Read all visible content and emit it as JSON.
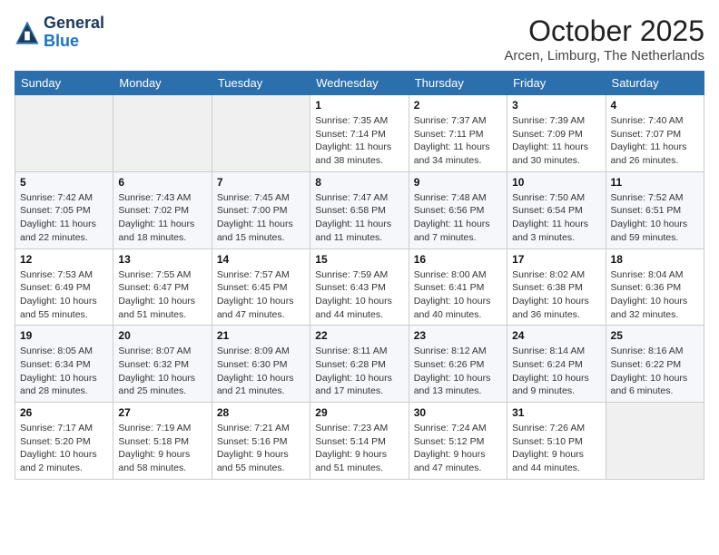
{
  "header": {
    "logo_line1": "General",
    "logo_line2": "Blue",
    "month": "October 2025",
    "location": "Arcen, Limburg, The Netherlands"
  },
  "weekdays": [
    "Sunday",
    "Monday",
    "Tuesday",
    "Wednesday",
    "Thursday",
    "Friday",
    "Saturday"
  ],
  "weeks": [
    [
      {
        "day": "",
        "info": ""
      },
      {
        "day": "",
        "info": ""
      },
      {
        "day": "",
        "info": ""
      },
      {
        "day": "1",
        "info": "Sunrise: 7:35 AM\nSunset: 7:14 PM\nDaylight: 11 hours\nand 38 minutes."
      },
      {
        "day": "2",
        "info": "Sunrise: 7:37 AM\nSunset: 7:11 PM\nDaylight: 11 hours\nand 34 minutes."
      },
      {
        "day": "3",
        "info": "Sunrise: 7:39 AM\nSunset: 7:09 PM\nDaylight: 11 hours\nand 30 minutes."
      },
      {
        "day": "4",
        "info": "Sunrise: 7:40 AM\nSunset: 7:07 PM\nDaylight: 11 hours\nand 26 minutes."
      }
    ],
    [
      {
        "day": "5",
        "info": "Sunrise: 7:42 AM\nSunset: 7:05 PM\nDaylight: 11 hours\nand 22 minutes."
      },
      {
        "day": "6",
        "info": "Sunrise: 7:43 AM\nSunset: 7:02 PM\nDaylight: 11 hours\nand 18 minutes."
      },
      {
        "day": "7",
        "info": "Sunrise: 7:45 AM\nSunset: 7:00 PM\nDaylight: 11 hours\nand 15 minutes."
      },
      {
        "day": "8",
        "info": "Sunrise: 7:47 AM\nSunset: 6:58 PM\nDaylight: 11 hours\nand 11 minutes."
      },
      {
        "day": "9",
        "info": "Sunrise: 7:48 AM\nSunset: 6:56 PM\nDaylight: 11 hours\nand 7 minutes."
      },
      {
        "day": "10",
        "info": "Sunrise: 7:50 AM\nSunset: 6:54 PM\nDaylight: 11 hours\nand 3 minutes."
      },
      {
        "day": "11",
        "info": "Sunrise: 7:52 AM\nSunset: 6:51 PM\nDaylight: 10 hours\nand 59 minutes."
      }
    ],
    [
      {
        "day": "12",
        "info": "Sunrise: 7:53 AM\nSunset: 6:49 PM\nDaylight: 10 hours\nand 55 minutes."
      },
      {
        "day": "13",
        "info": "Sunrise: 7:55 AM\nSunset: 6:47 PM\nDaylight: 10 hours\nand 51 minutes."
      },
      {
        "day": "14",
        "info": "Sunrise: 7:57 AM\nSunset: 6:45 PM\nDaylight: 10 hours\nand 47 minutes."
      },
      {
        "day": "15",
        "info": "Sunrise: 7:59 AM\nSunset: 6:43 PM\nDaylight: 10 hours\nand 44 minutes."
      },
      {
        "day": "16",
        "info": "Sunrise: 8:00 AM\nSunset: 6:41 PM\nDaylight: 10 hours\nand 40 minutes."
      },
      {
        "day": "17",
        "info": "Sunrise: 8:02 AM\nSunset: 6:38 PM\nDaylight: 10 hours\nand 36 minutes."
      },
      {
        "day": "18",
        "info": "Sunrise: 8:04 AM\nSunset: 6:36 PM\nDaylight: 10 hours\nand 32 minutes."
      }
    ],
    [
      {
        "day": "19",
        "info": "Sunrise: 8:05 AM\nSunset: 6:34 PM\nDaylight: 10 hours\nand 28 minutes."
      },
      {
        "day": "20",
        "info": "Sunrise: 8:07 AM\nSunset: 6:32 PM\nDaylight: 10 hours\nand 25 minutes."
      },
      {
        "day": "21",
        "info": "Sunrise: 8:09 AM\nSunset: 6:30 PM\nDaylight: 10 hours\nand 21 minutes."
      },
      {
        "day": "22",
        "info": "Sunrise: 8:11 AM\nSunset: 6:28 PM\nDaylight: 10 hours\nand 17 minutes."
      },
      {
        "day": "23",
        "info": "Sunrise: 8:12 AM\nSunset: 6:26 PM\nDaylight: 10 hours\nand 13 minutes."
      },
      {
        "day": "24",
        "info": "Sunrise: 8:14 AM\nSunset: 6:24 PM\nDaylight: 10 hours\nand 9 minutes."
      },
      {
        "day": "25",
        "info": "Sunrise: 8:16 AM\nSunset: 6:22 PM\nDaylight: 10 hours\nand 6 minutes."
      }
    ],
    [
      {
        "day": "26",
        "info": "Sunrise: 7:17 AM\nSunset: 5:20 PM\nDaylight: 10 hours\nand 2 minutes."
      },
      {
        "day": "27",
        "info": "Sunrise: 7:19 AM\nSunset: 5:18 PM\nDaylight: 9 hours\nand 58 minutes."
      },
      {
        "day": "28",
        "info": "Sunrise: 7:21 AM\nSunset: 5:16 PM\nDaylight: 9 hours\nand 55 minutes."
      },
      {
        "day": "29",
        "info": "Sunrise: 7:23 AM\nSunset: 5:14 PM\nDaylight: 9 hours\nand 51 minutes."
      },
      {
        "day": "30",
        "info": "Sunrise: 7:24 AM\nSunset: 5:12 PM\nDaylight: 9 hours\nand 47 minutes."
      },
      {
        "day": "31",
        "info": "Sunrise: 7:26 AM\nSunset: 5:10 PM\nDaylight: 9 hours\nand 44 minutes."
      },
      {
        "day": "",
        "info": ""
      }
    ]
  ]
}
